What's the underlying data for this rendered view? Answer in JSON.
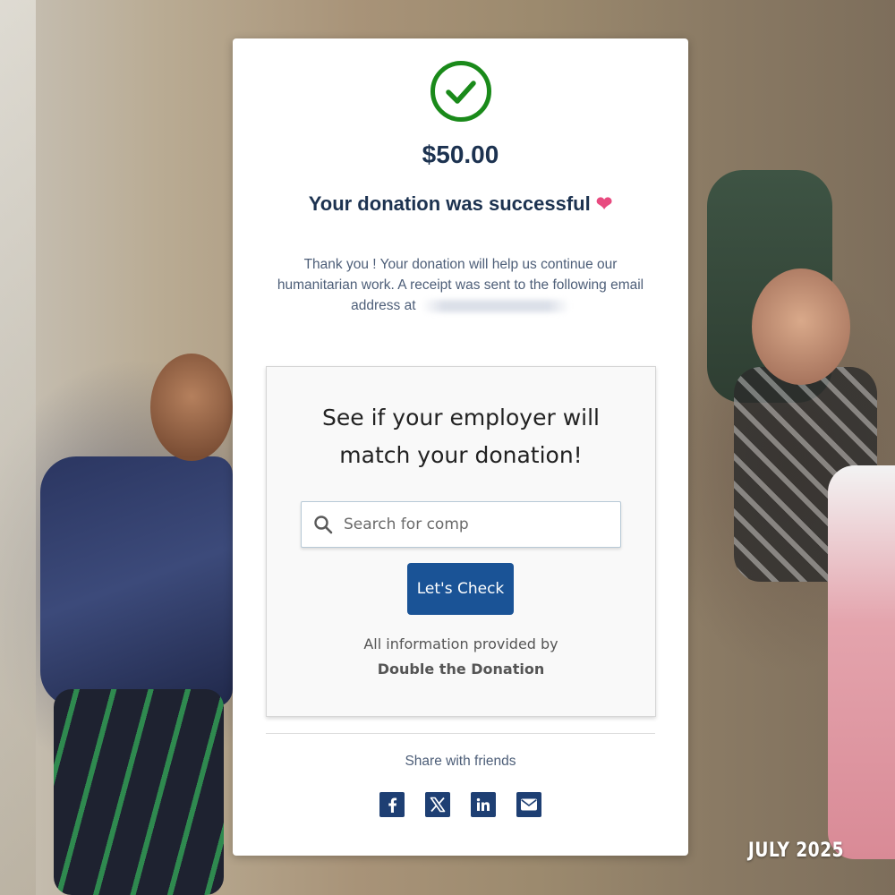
{
  "background": {
    "date_stamp": "JULY 2025"
  },
  "confirmation": {
    "amount": "$50.00",
    "title": "Your donation was successful",
    "title_emoji": "❤",
    "message": "Thank you ! Your donation will help us continue our humanitarian work. A receipt was sent to the following email address at",
    "email_redacted": true
  },
  "employer_match": {
    "heading": "See if your employer will match your donation!",
    "search": {
      "placeholder": "Search for comp",
      "value": ""
    },
    "button_label": "Let's Check",
    "provided_by_text": "All information provided by",
    "provider_name": "Double the Donation"
  },
  "share": {
    "label": "Share with friends",
    "icons": [
      "facebook-icon",
      "x-icon",
      "linkedin-icon",
      "email-icon"
    ]
  },
  "colors": {
    "success_green": "#1a8a1a",
    "heading_navy": "#1c3250",
    "button_blue": "#1a5396",
    "share_icon_bg": "#1e3f73",
    "heart_pink": "#e84a7f"
  }
}
